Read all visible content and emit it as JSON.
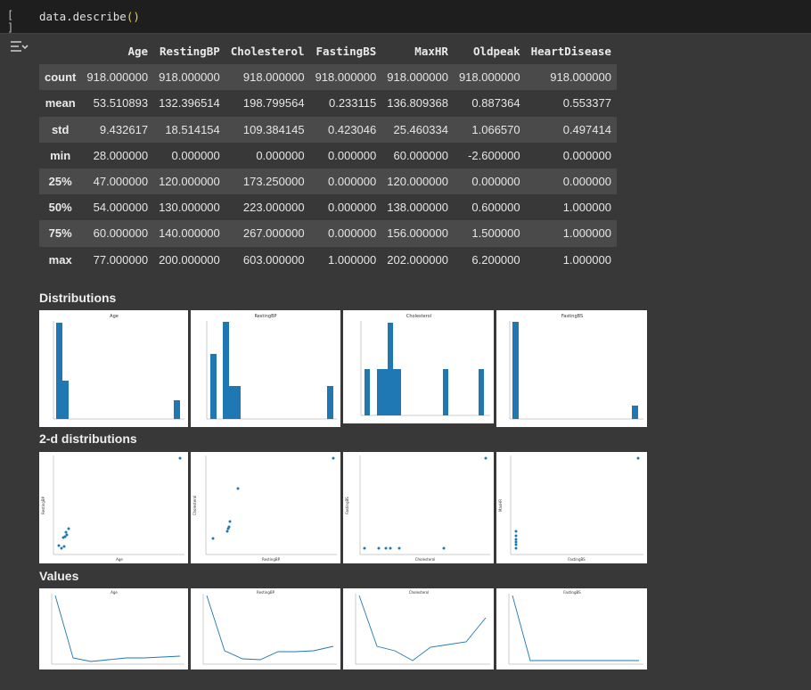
{
  "cell": {
    "run_label": "[ ]",
    "code_prefix": "data.describe",
    "code_parens": "()"
  },
  "table": {
    "columns": [
      "",
      "Age",
      "RestingBP",
      "Cholesterol",
      "FastingBS",
      "MaxHR",
      "Oldpeak",
      "HeartDisease"
    ],
    "rows": [
      [
        "count",
        "918.000000",
        "918.000000",
        "918.000000",
        "918.000000",
        "918.000000",
        "918.000000",
        "918.000000"
      ],
      [
        "mean",
        "53.510893",
        "132.396514",
        "198.799564",
        "0.233115",
        "136.809368",
        "0.887364",
        "0.553377"
      ],
      [
        "std",
        "9.432617",
        "18.514154",
        "109.384145",
        "0.423046",
        "25.460334",
        "1.066570",
        "0.497414"
      ],
      [
        "min",
        "28.000000",
        "0.000000",
        "0.000000",
        "0.000000",
        "60.000000",
        "-2.600000",
        "0.000000"
      ],
      [
        "25%",
        "47.000000",
        "120.000000",
        "173.250000",
        "0.000000",
        "120.000000",
        "0.000000",
        "0.000000"
      ],
      [
        "50%",
        "54.000000",
        "130.000000",
        "223.000000",
        "0.000000",
        "138.000000",
        "0.600000",
        "1.000000"
      ],
      [
        "75%",
        "60.000000",
        "140.000000",
        "267.000000",
        "0.000000",
        "156.000000",
        "1.500000",
        "1.000000"
      ],
      [
        "max",
        "77.000000",
        "200.000000",
        "603.000000",
        "1.000000",
        "202.000000",
        "6.200000",
        "1.000000"
      ]
    ]
  },
  "sections": {
    "distributions": "Distributions",
    "two_d": "2-d distributions",
    "values": "Values"
  },
  "thumbnails": {
    "distributions": [
      {
        "title": "Age"
      },
      {
        "title": "RestingBP"
      },
      {
        "title": "Cholesterol"
      },
      {
        "title": "FastingBS"
      }
    ],
    "two_d": [
      {
        "xlabel": "Age",
        "ylabel": "RestingBP"
      },
      {
        "xlabel": "RestingBP",
        "ylabel": "Cholesterol"
      },
      {
        "xlabel": "Cholesterol",
        "ylabel": "FastingBS"
      },
      {
        "xlabel": "FastingBS",
        "ylabel": "MaxHR"
      }
    ],
    "values": [
      {
        "title": "Age"
      },
      {
        "title": "RestingBP"
      },
      {
        "title": "Cholesterol"
      },
      {
        "title": "FastingBS"
      }
    ]
  },
  "colors": {
    "series": "#1f77b4",
    "background": "#383838",
    "header": "#1e1e1e"
  }
}
